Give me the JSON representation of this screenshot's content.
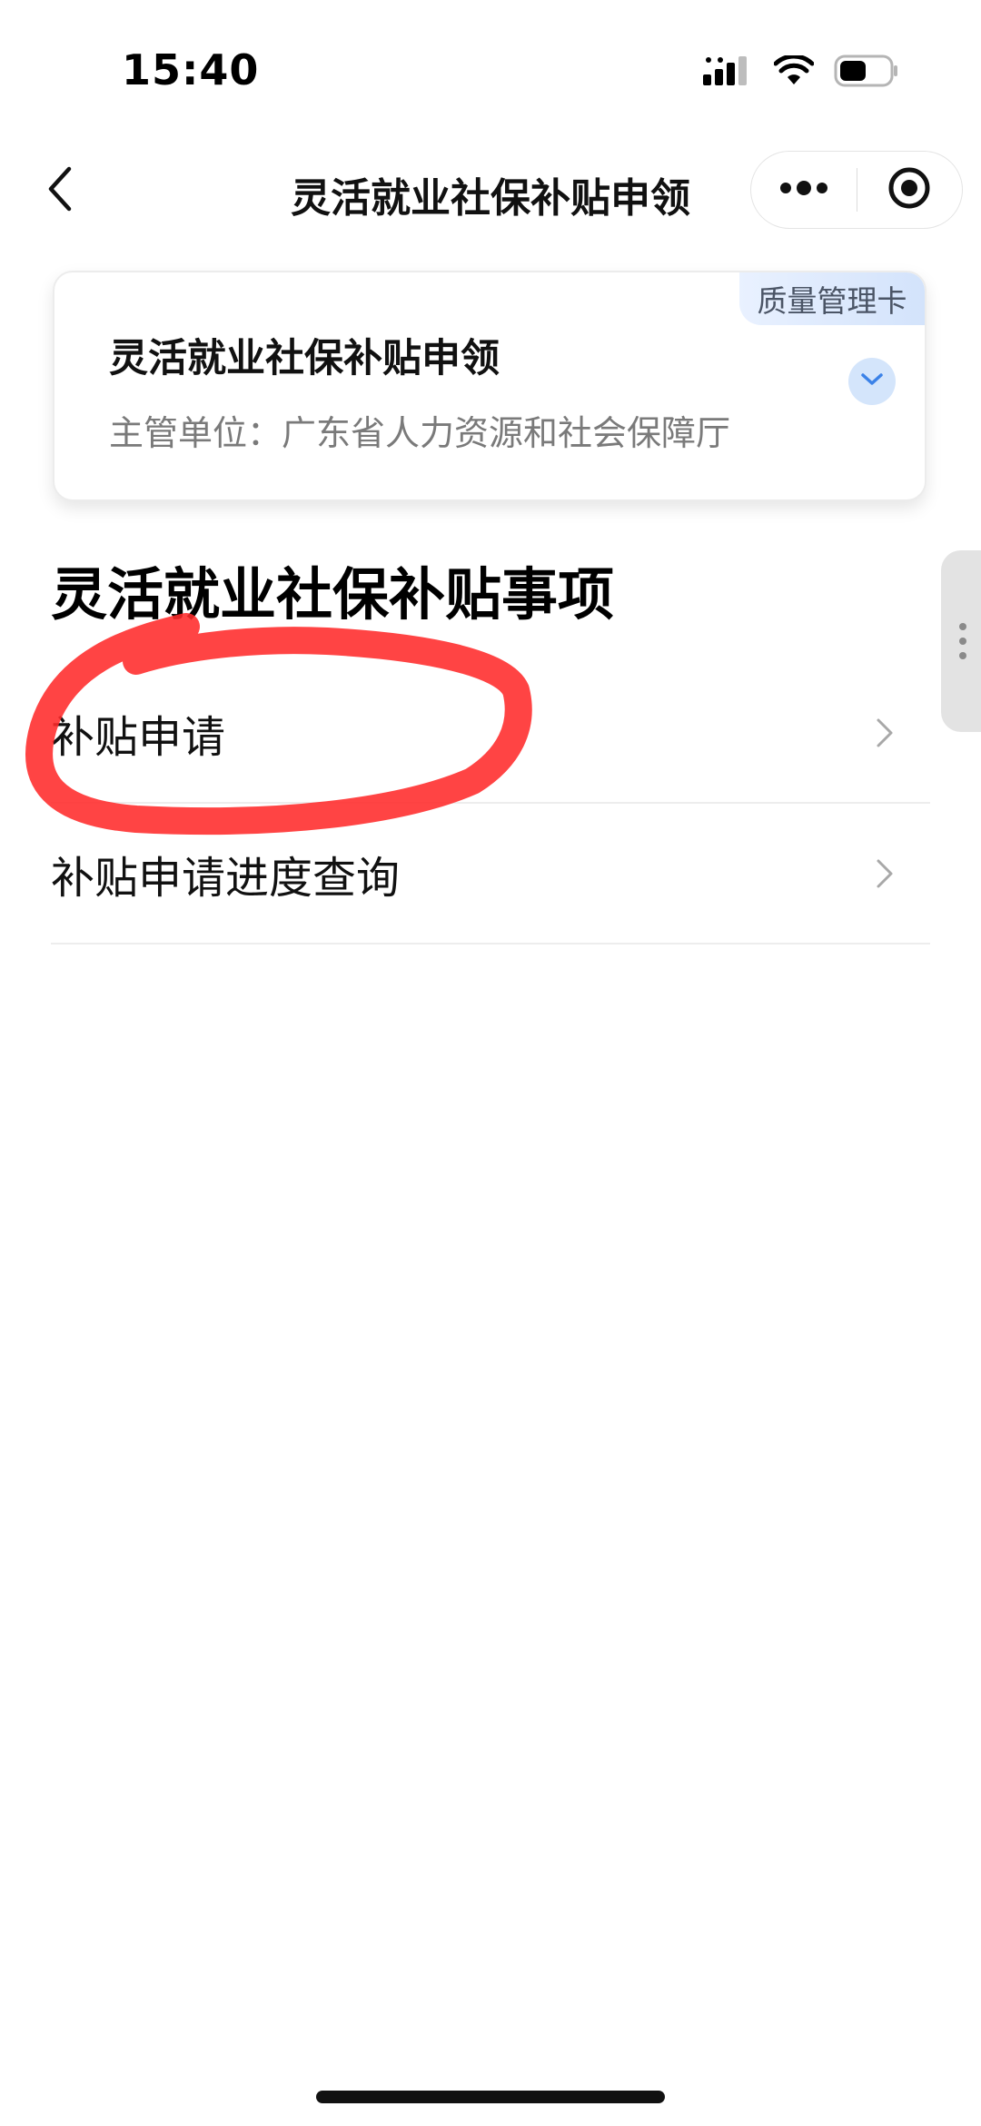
{
  "status_bar": {
    "time": "15:40",
    "icons": [
      "cellular-signal-icon",
      "wifi-icon",
      "battery-icon"
    ]
  },
  "nav": {
    "title": "灵活就业社保补贴申领",
    "back_icon": "chevron-left-icon",
    "more_icon": "more-dots-icon",
    "close_icon": "target-circle-icon"
  },
  "card": {
    "badge": "质量管理卡",
    "title": "灵活就业社保补贴申领",
    "department": "主管单位：广东省人力资源和社会保障厅",
    "expand_icon": "chevron-down-icon"
  },
  "section": {
    "title": "灵活就业社保补贴事项",
    "items": [
      {
        "label": "补贴申请"
      },
      {
        "label": "补贴申请进度查询"
      }
    ]
  },
  "colors": {
    "marker": "#ff2a2a",
    "badge_bg": "#d3e3fb",
    "expand_bg": "#d4e5fb",
    "divider": "#ededed"
  }
}
